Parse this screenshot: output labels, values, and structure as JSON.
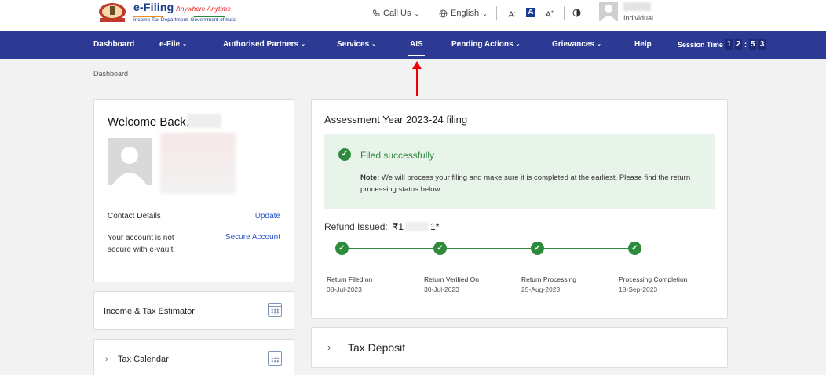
{
  "header": {
    "logo_title": "e-Filing",
    "logo_tagline": "Anywhere Anytime",
    "logo_subtitle": "Income Tax Department, Government of India",
    "call_us": "Call Us",
    "language": "English",
    "font_decrease": "A",
    "font_normal": "A",
    "font_increase": "A",
    "user_role": "Individual"
  },
  "nav": {
    "items": [
      {
        "label": "Dashboard"
      },
      {
        "label": "e-File"
      },
      {
        "label": "Authorised Partners"
      },
      {
        "label": "Services"
      },
      {
        "label": "AIS"
      },
      {
        "label": "Pending Actions"
      },
      {
        "label": "Grievances"
      },
      {
        "label": "Help"
      }
    ],
    "session_label": "Session Time",
    "session_digits": [
      "1",
      "2",
      "5",
      "3"
    ],
    "active_item": "AIS"
  },
  "breadcrumb": "Dashboard",
  "welcome": {
    "title": "Welcome Back,",
    "contact_label": "Contact Details",
    "update_link": "Update",
    "secure_text": "Your account is not secure with e-vault",
    "secure_link": "Secure Account"
  },
  "income_estimator": {
    "title": "Income & Tax Estimator"
  },
  "tax_calendar": {
    "title": "Tax Calendar"
  },
  "assessment": {
    "title": "Assessment Year 2023-24 filing",
    "status_title": "Filed successfully",
    "note_label": "Note:",
    "note_text": "We will process your filing and make sure it is completed at the earliest. Please find the return processing status below.",
    "refund_label": "Refund Issued:",
    "refund_prefix": "₹1",
    "refund_suffix": "1*",
    "steps": [
      {
        "label": "Return Filed on",
        "date": "08-Jul-2023"
      },
      {
        "label": "Return Verified On",
        "date": "30-Jul-2023"
      },
      {
        "label": "Return Processing",
        "date": "25-Aug-2023"
      },
      {
        "label": "Processing Completion",
        "date": "18-Sep-2023"
      }
    ]
  },
  "tax_deposit": {
    "title": "Tax Deposit"
  },
  "colors": {
    "nav_bg": "#2d3a94",
    "success": "#2e8b3e",
    "link": "#2a55c8",
    "annotation_arrow": "#e00000"
  }
}
